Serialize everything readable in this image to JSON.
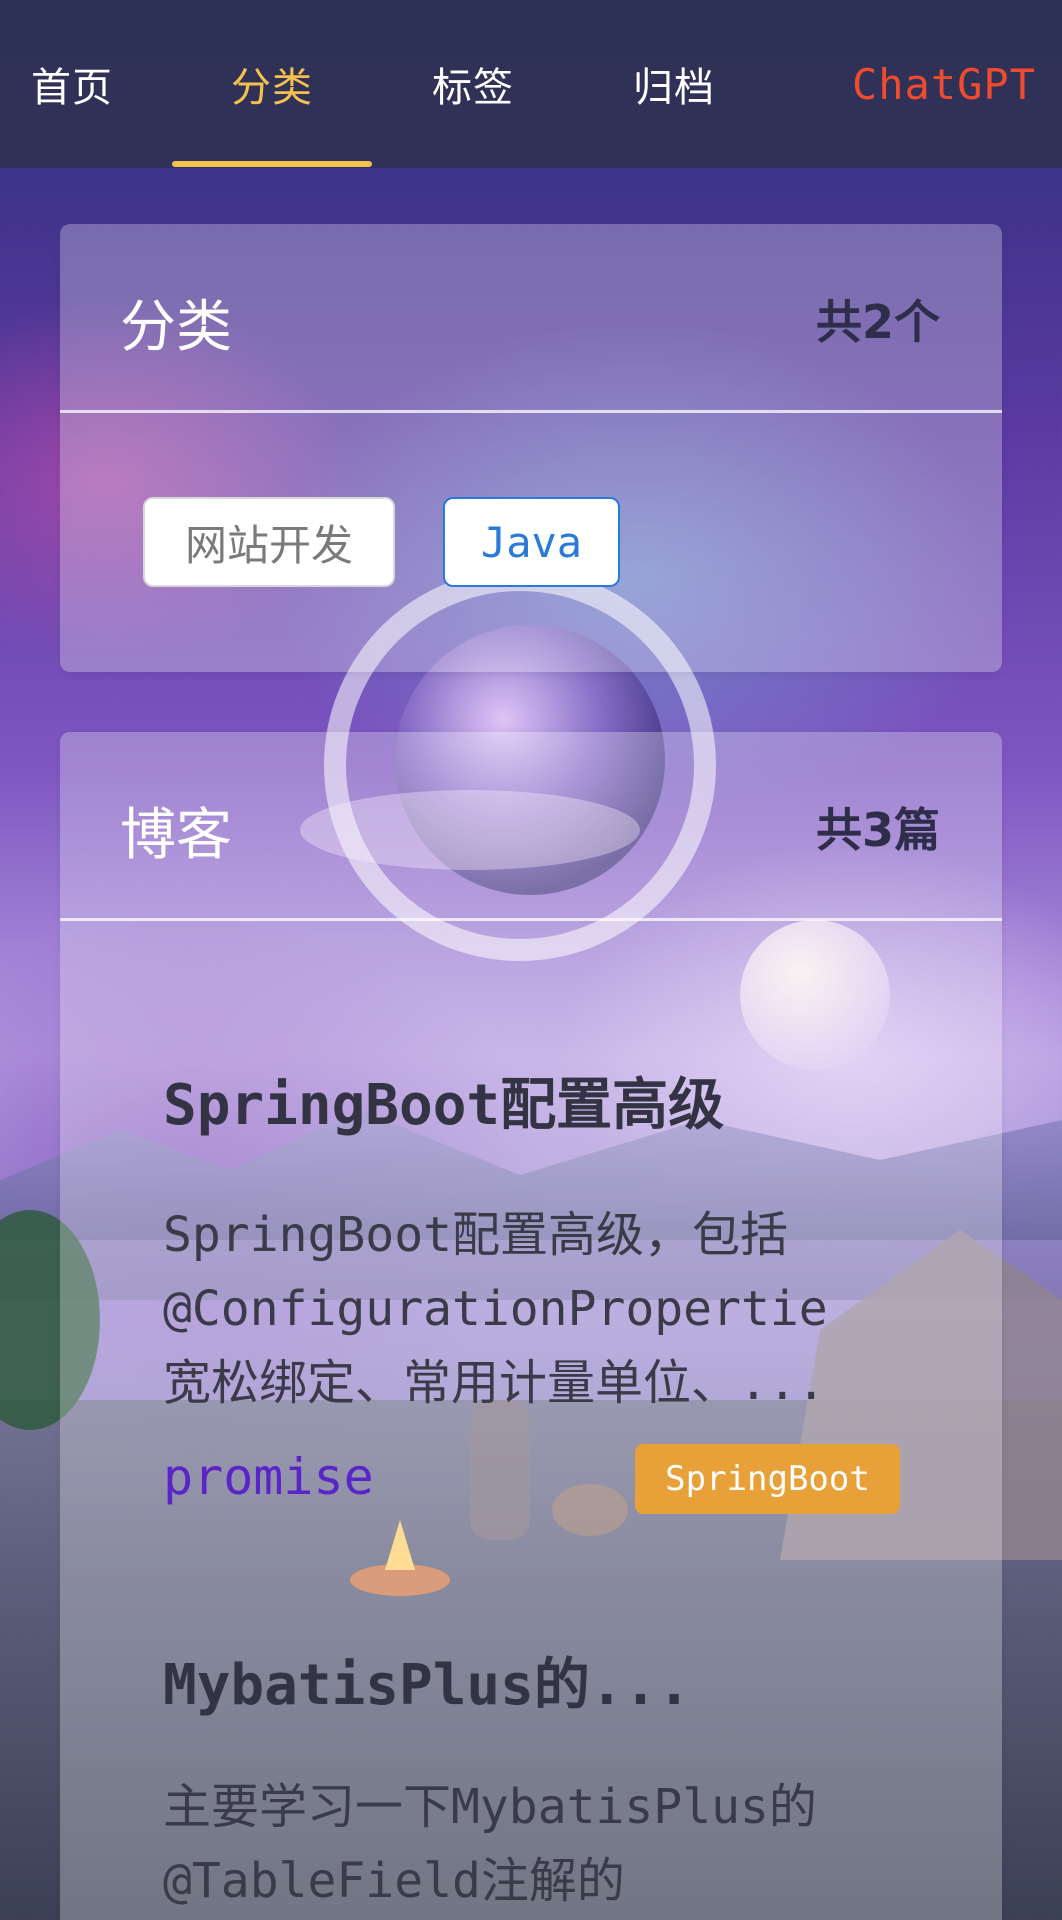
{
  "nav": {
    "items": [
      {
        "label": "首页"
      },
      {
        "label": "分类"
      },
      {
        "label": "标签"
      },
      {
        "label": "归档"
      },
      {
        "label": "ChatGPT"
      }
    ],
    "active_index": 1
  },
  "categories": {
    "title": "分类",
    "count": "共2个",
    "chips": [
      "网站开发",
      "Java"
    ]
  },
  "blogs": {
    "title": "博客",
    "count": "共3篇",
    "posts": [
      {
        "title": "SpringBoot配置高级",
        "desc_lines": [
          "SpringBoot配置高级，包括",
          "@ConfigurationPropertie",
          "宽松绑定、常用计量单位、..."
        ],
        "author": "promise",
        "tag": "SpringBoot"
      },
      {
        "title": "MybatisPlus的...",
        "desc_lines": [
          "主要学习一下MybatisPlus的",
          "@TableField注解的"
        ]
      }
    ]
  },
  "colors": {
    "nav_active": "#f4c14c",
    "nav_special": "#ef4b2f",
    "author": "#5a25c8",
    "tag_bg": "#e8a038",
    "chip_selected": "#2a7ad8"
  }
}
